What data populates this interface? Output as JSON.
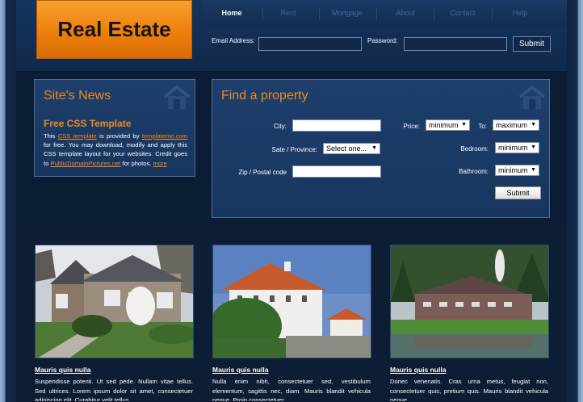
{
  "header": {
    "logo_text": "Real Estate",
    "nav": [
      "Home",
      "Rent",
      "Mortgage",
      "About",
      "Contact",
      "Help"
    ],
    "email_label": "Email Address:",
    "password_label": "Password:",
    "submit_label": "Submit"
  },
  "news": {
    "title": "Site's News",
    "subtitle": "Free CSS Template",
    "t1": "This ",
    "link1": "CSS template",
    "t2": " is provided by ",
    "link2": "templatemo.com",
    "t3": " for free. You may download, modify and apply this CSS template layout for your websites. Credit goes to ",
    "link3": "PublicDomainPictures.net",
    "t4": " for photos. ",
    "link4": "more"
  },
  "find": {
    "title": "Find a property",
    "city_label": "City:",
    "state_label": "Sate / Province:",
    "state_value": "Select one...",
    "zip_label": "Zip / Postal code",
    "price_label": "Price:",
    "price_min": "minimum",
    "to_label": "To:",
    "price_max": "maximum",
    "bedroom_label": "Bedroom:",
    "bedroom_value": "minimum",
    "bathroom_label": "Bathroom:",
    "bathroom_value": "minimum",
    "submit_label": "Submit"
  },
  "listings": [
    {
      "title": "Mauris quis nulla",
      "text": "Suspendisse potenti. Ut sed pede. Nullam vitae tellus. Sed ultrices. Lorem ipsum dolor sit amet, consectetuer adipiscing elit. Curabitur velit tellus."
    },
    {
      "title": "Mauris quis nulla",
      "text": "Nulla enim nibh, consectetuer sed, vestibulum elementum, sagittis nec, diam. Mauris blandit vehicula neque. Proin consectetuer."
    },
    {
      "title": "Mauris quis nulla",
      "text": "Donec venenatis. Cras urna metus, feugiat non, consectetuer quis, pretium quis. Mauris blandit vehicula neque."
    }
  ],
  "colors": {
    "accent": "#f08a1d",
    "panel": "#1b3a66",
    "background": "#0b1d35"
  },
  "icons": {
    "box_icon": "house-icon"
  }
}
